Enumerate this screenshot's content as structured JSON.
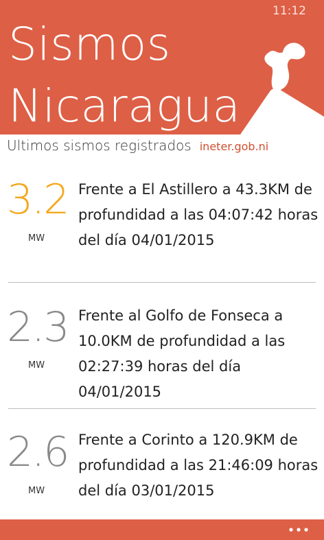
{
  "status_bar": {
    "time": "11:12"
  },
  "header": {
    "title_line1": "Sismos",
    "title_line2": "Nicaragua",
    "illustration": "volcano-icon"
  },
  "subheader": {
    "subtitle": "Ultimos sismos registrados",
    "source_link": "ineter.gob.ni"
  },
  "quakes": [
    {
      "magnitude": "3.2",
      "unit": "MW",
      "description": "Frente a El Astillero a 43.3KM de profundidad a las 04:07:42 horas del día 04/01/2015",
      "highlighted": true
    },
    {
      "magnitude": "2.3",
      "unit": "MW",
      "description": "Frente al Golfo de Fonseca a 10.0KM de profundidad a las 02:27:39 horas del día 04/01/2015",
      "highlighted": false
    },
    {
      "magnitude": "2.6",
      "unit": "MW",
      "description": "Frente a Corinto a 120.9KM de profundidad a las 21:46:09 horas del día 03/01/2015",
      "highlighted": false
    }
  ],
  "colors": {
    "brand": "#dd5f46",
    "highlight_magnitude": "#f4a81c",
    "magnitude": "#8a8a8a",
    "link": "#d0502f"
  },
  "app_bar": {
    "more_icon": "ellipsis-icon"
  }
}
